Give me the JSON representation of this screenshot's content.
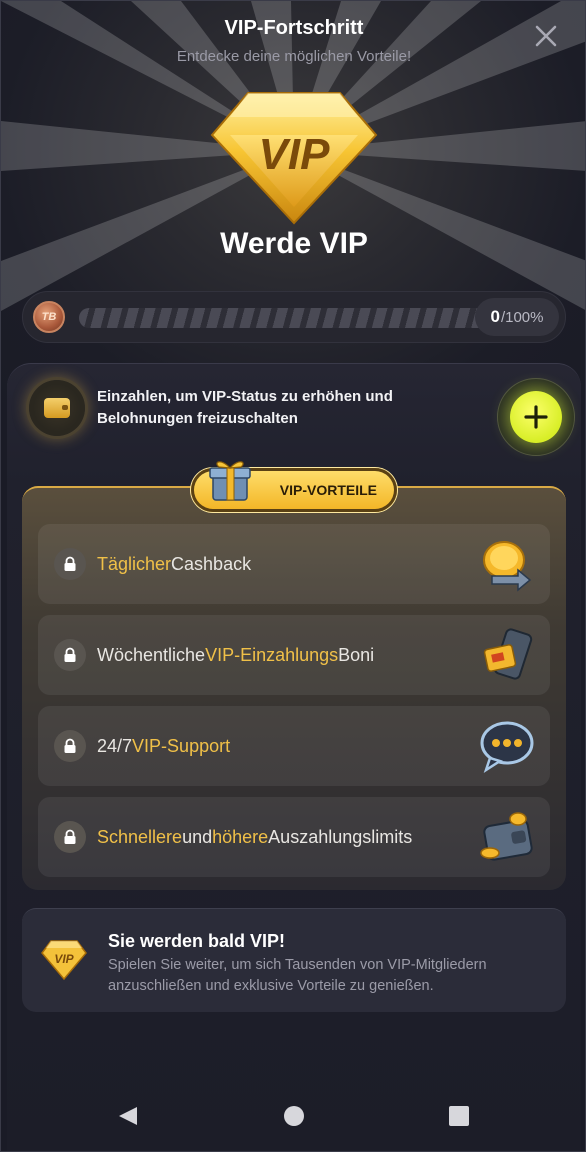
{
  "header": {
    "title": "VIP-Fortschritt",
    "subtitle": "Entdecke deine möglichen Vorteile!"
  },
  "hero": {
    "gem_label": "VIP",
    "title": "Werde VIP"
  },
  "progress": {
    "coin_label": "TB",
    "value": "0",
    "suffix": "/100%",
    "fraction": 0
  },
  "deposit": {
    "text": "Einzahlen, um VIP-Status zu erhöhen und Belohnungen freizuschalten"
  },
  "benefits": {
    "badge": "VIP-VORTEILE",
    "items": [
      {
        "parts": [
          {
            "t": "Täglicher",
            "hl": true
          },
          {
            "t": " Cashback",
            "hl": false
          }
        ],
        "icon": "coin-cashback-icon"
      },
      {
        "parts": [
          {
            "t": "Wöchentliche ",
            "hl": false
          },
          {
            "t": "VIP-Einzahlungs",
            "hl": true
          },
          {
            "t": " Boni",
            "hl": false
          }
        ],
        "icon": "phone-deposit-icon"
      },
      {
        "parts": [
          {
            "t": "24/7 ",
            "hl": false
          },
          {
            "t": "VIP-Support",
            "hl": true
          }
        ],
        "icon": "chat-bubble-icon"
      },
      {
        "parts": [
          {
            "t": "Schnellere",
            "hl": true
          },
          {
            "t": " und ",
            "hl": false
          },
          {
            "t": "höhere",
            "hl": true
          },
          {
            "t": " Auszahlungslimits",
            "hl": false
          }
        ],
        "icon": "wallet-coins-icon"
      }
    ]
  },
  "soon": {
    "gem_label": "VIP",
    "title": "Sie werden bald VIP!",
    "text": "Spielen Sie weiter, um sich Tausenden von VIP-Mitgliedern anzuschließen und exklusive Vorteile zu genießen."
  },
  "colors": {
    "accent_gold": "#f0c048",
    "plus_button": "#e4f531",
    "background": "#1a1b26"
  }
}
